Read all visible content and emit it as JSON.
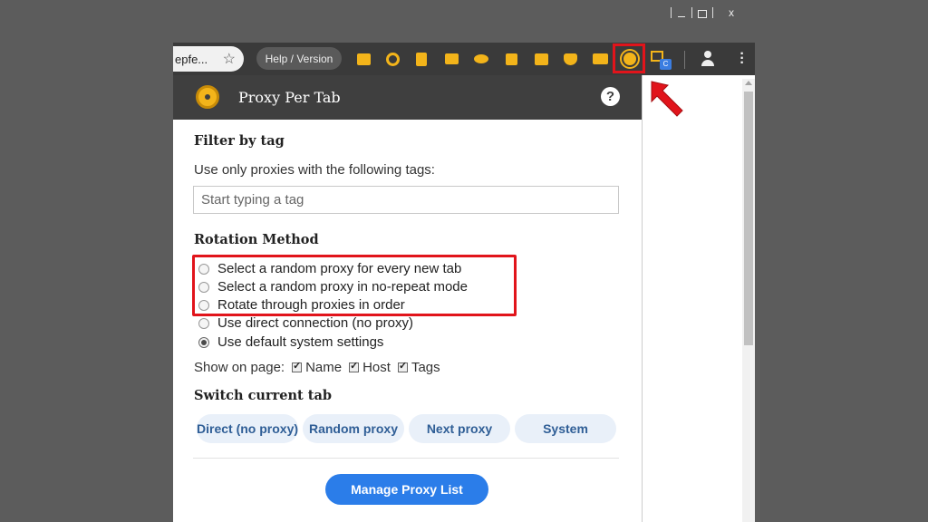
{
  "window_controls": {
    "minimize": "",
    "maximize": "",
    "close": "x"
  },
  "toolbar": {
    "url_fragment": "epfe...",
    "help_version_label": "Help / Version",
    "extensions": [
      "ext-grid-icon",
      "ext-timer-icon",
      "ext-bag-icon",
      "ext-list-icon",
      "ext-eye-icon",
      "ext-box-icon",
      "ext-arrow-icon",
      "ext-shield-icon",
      "ext-play-icon",
      "proxy-per-tab-icon",
      "ext-camera-c-icon"
    ],
    "camera_badge": "C"
  },
  "popup": {
    "title": "Proxy Per Tab",
    "help": "?",
    "filter": {
      "heading": "Filter by tag",
      "description": "Use only proxies with the following tags:",
      "placeholder": "Start typing a tag"
    },
    "rotation": {
      "heading": "Rotation Method",
      "options": [
        {
          "label": "Select a random proxy for every new tab",
          "checked": false
        },
        {
          "label": "Select a random proxy in no-repeat mode",
          "checked": false
        },
        {
          "label": "Rotate through proxies in order",
          "checked": false
        },
        {
          "label": "Use direct connection (no proxy)",
          "checked": false
        },
        {
          "label": "Use default system settings",
          "checked": true
        }
      ]
    },
    "show_on_page": {
      "label": "Show on page:",
      "options": [
        "Name",
        "Host",
        "Tags"
      ]
    },
    "switch": {
      "heading": "Switch current tab",
      "buttons": [
        "Direct (no proxy)",
        "Random proxy",
        "Next proxy",
        "System"
      ]
    },
    "manage_label": "Manage Proxy List"
  },
  "colors": {
    "accent": "#2b7de9",
    "highlight": "#e1141b",
    "extension_yellow": "#f3b41a"
  }
}
